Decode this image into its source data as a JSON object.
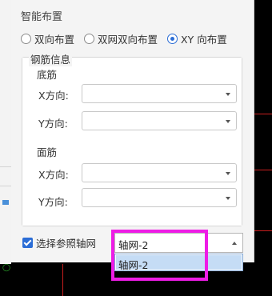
{
  "panel": {
    "title": "智能布置",
    "radio_options": [
      {
        "label": "双向布置",
        "checked": false
      },
      {
        "label": "双网双向布置",
        "checked": false
      },
      {
        "label": "XY 向布置",
        "checked": true
      }
    ],
    "group_title": "钢筋信息",
    "bottom_rebar": {
      "title": "底筋",
      "x_label": "X方向:",
      "x_value": "",
      "y_label": "Y方向:",
      "y_value": ""
    },
    "top_rebar": {
      "title": "面筋",
      "x_label": "X方向:",
      "x_value": "",
      "y_label": "Y方向:",
      "y_value": ""
    },
    "reference_axis": {
      "label": "选择参照轴网",
      "checked": true
    },
    "axis_select": {
      "value": "轴网-2",
      "options": [
        "轴网-2"
      ]
    }
  },
  "colors": {
    "accent": "#2b6dd6",
    "highlight": "#ee1ce6",
    "selected_option": "#c5dcf5",
    "cad_line": "#c81e1e"
  }
}
